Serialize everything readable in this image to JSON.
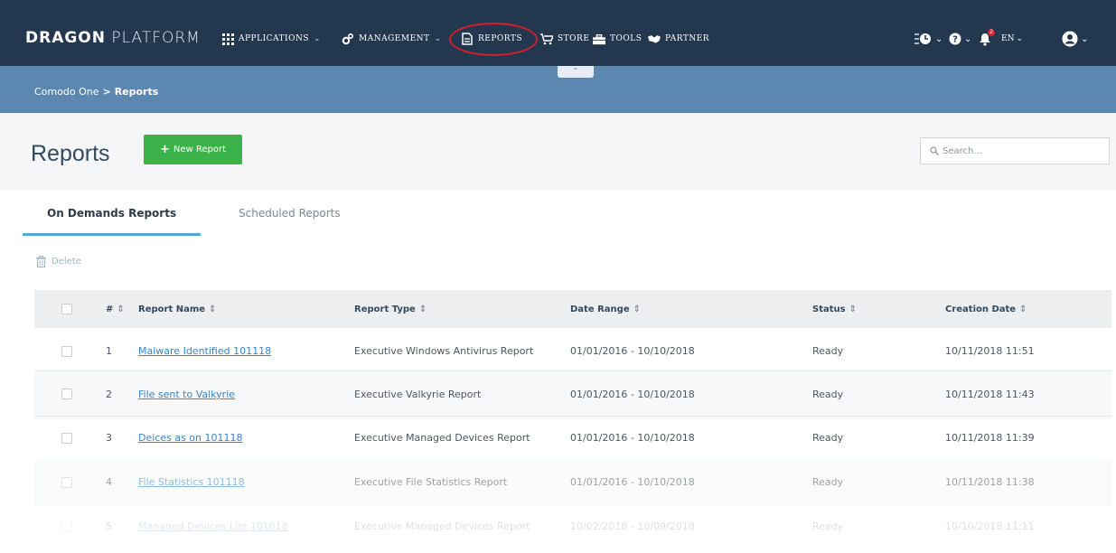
{
  "brand": {
    "bold": "DRAGON",
    "light": "PLATFORM"
  },
  "nav": {
    "applications": "APPLICATIONS",
    "management": "MANAGEMENT",
    "reports": "REPORTS",
    "store": "STORE",
    "tools": "TOOLS",
    "partner": "PARTNER",
    "language": "EN",
    "notification_count": "2"
  },
  "breadcrumb": {
    "root": "Comodo One",
    "separator": ">",
    "current": "Reports"
  },
  "page": {
    "title": "Reports",
    "new_report_label": "New Report",
    "search_placeholder": "Search..."
  },
  "tabs": [
    {
      "label": "On Demands Reports",
      "active": true
    },
    {
      "label": "Scheduled Reports",
      "active": false
    }
  ],
  "toolbar": {
    "delete_label": "Delete"
  },
  "table": {
    "columns": [
      "#",
      "Report Name",
      "Report Type",
      "Date Range",
      "Status",
      "Creation Date"
    ],
    "sort_icon": "⇕",
    "rows": [
      {
        "num": "1",
        "name": "Malware Identified 101118",
        "type": "Executive Windows Antivirus Report",
        "range": "01/01/2016 - 10/10/2018",
        "status": "Ready",
        "created": "10/11/2018 11:51"
      },
      {
        "num": "2",
        "name": "File sent to Valkyrie",
        "type": "Executive Valkyrie Report",
        "range": "01/01/2016 - 10/10/2018",
        "status": "Ready",
        "created": "10/11/2018 11:43"
      },
      {
        "num": "3",
        "name": "Deices as on 101118",
        "type": "Executive Managed Devices Report",
        "range": "01/01/2016 - 10/10/2018",
        "status": "Ready",
        "created": "10/11/2018 11:39"
      },
      {
        "num": "4",
        "name": "File Statistics 101118",
        "type": "Executive File Statistics Report",
        "range": "01/01/2016 - 10/10/2018",
        "status": "Ready",
        "created": "10/11/2018 11:38"
      },
      {
        "num": "5",
        "name": "Managed Devices List 101018",
        "type": "Executive Managed Devices Report",
        "range": "10/02/2018 - 10/09/2018",
        "status": "Ready",
        "created": "10/10/2018 11:11"
      }
    ]
  },
  "colors": {
    "topnav": "#23374f",
    "crumbbar": "#5c87b1",
    "accent_green": "#3cb34a",
    "link_blue": "#3b84c2",
    "tab_underline": "#4fa7e1",
    "highlight_red": "#d21f2b"
  },
  "icons": {
    "applications": "grid-icon",
    "management": "gears-icon",
    "reports": "document-icon",
    "store": "cart-icon",
    "tools": "toolbox-icon",
    "partner": "handshake-icon",
    "status": "status-icon",
    "help": "help-icon",
    "notifications": "bell-icon",
    "user": "user-icon",
    "search": "search-icon",
    "delete": "trash-icon"
  }
}
